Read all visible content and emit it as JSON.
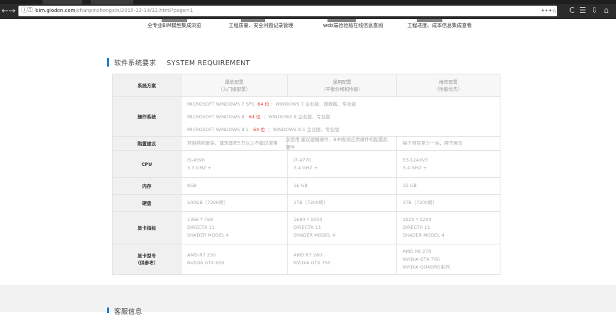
{
  "browser": {
    "url_host": "bim.glodon.com",
    "url_path": "/chanpinzhongxin/2015-12-14/12.html?page=1"
  },
  "features": [
    "全专业BIM模型集成浏览",
    "工程质量、安全问题记录管理",
    "web端验验船在线信息查阅",
    "工程进度、成本信息集成查看"
  ],
  "section": {
    "title_cn": "软件系统要求",
    "title_en": "SYSTEM REQUIREMENT"
  },
  "next_section": {
    "title_cn": "客服信息"
  },
  "table": {
    "scheme_label": "系统方案",
    "columns": [
      {
        "title": "最低配置",
        "sub": "（入门级配置）"
      },
      {
        "title": "通用配置",
        "sub": "（平衡价格和性能）"
      },
      {
        "title": "推荐配置",
        "sub": "（性能优先）"
      }
    ],
    "os": {
      "label": "操作系统",
      "lines": [
        {
          "pre": "MICROSOFT WINDOWS 7 SP1",
          "bit": "64 位",
          "post": "：WINDOWS 7 企业版、旗舰版、专业版"
        },
        {
          "pre": "MICROSOFT WINDOWS 8",
          "bit": "64 位",
          "post": "：WINDOWS 8 企业版、专业版"
        },
        {
          "pre": "MICROSOFT WINDOWS 8.1",
          "bit": "64 位",
          "post": "：WINDOWS 8.1 企业版、专业版"
        }
      ]
    },
    "rows": [
      {
        "label": "购置建议",
        "values": [
          [
            "项目结构复杂，建筑面积5万以上不建议使用"
          ],
          [
            "议使用 建议建模硬件，BIM系统应用硬件均配置此硬件"
          ],
          [
            "每个项目至少一台，用于展示"
          ]
        ]
      },
      {
        "label": "CPU",
        "values": [
          [
            "I5-4590",
            "3.3 GHZ +"
          ],
          [
            "I7-4770",
            "3.4 GHZ +"
          ],
          [
            "E3-1240V3",
            "3.4 GHZ +"
          ]
        ]
      },
      {
        "label": "内存",
        "values": [
          [
            "8GB"
          ],
          [
            "16 GB"
          ],
          [
            "32 GB"
          ]
        ]
      },
      {
        "label": "硬盘",
        "values": [
          [
            "500GB（7200转）"
          ],
          [
            "1TB（7200转）"
          ],
          [
            "1TB（7200转）"
          ]
        ]
      },
      {
        "label": "显卡指标",
        "values": [
          [
            "1366 * 768",
            "DIRECTX 11",
            "SHADER MODEL 4"
          ],
          [
            "1680 * 1050",
            "DIRECTX 11",
            "SHADER MODEL 4"
          ],
          [
            "1920 * 1200",
            "DIRECTX 11",
            "SHADER MODEL 4"
          ]
        ]
      },
      {
        "label": "显卡型号\n（供参考）",
        "values": [
          [
            "AMD R7 250",
            "NVIDIA GTX 650"
          ],
          [
            "AMD R7 260",
            "NVIDIA GTX 750"
          ],
          [
            "AMD R9 270",
            "NVIDIA GTX 760",
            "NVIDIA QUADRO系列"
          ]
        ]
      }
    ]
  },
  "colors": {
    "accent": "#1d7fcf",
    "highlight": "#e03c31",
    "label_bg": "#f0f0f0"
  }
}
